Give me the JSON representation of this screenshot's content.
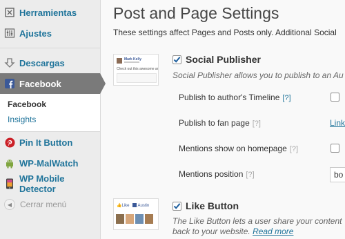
{
  "sidebar": {
    "items": [
      {
        "label": "Herramientas",
        "icon": "tools-icon"
      },
      {
        "label": "Ajustes",
        "icon": "settings-icon"
      },
      {
        "label": "Descargas",
        "icon": "download-icon"
      },
      {
        "label": "Facebook",
        "icon": "facebook-icon"
      },
      {
        "label": "Pin It Button",
        "icon": "pinterest-icon"
      },
      {
        "label": "WP-MalWatch",
        "icon": "android-icon"
      },
      {
        "label": "WP Mobile Detector",
        "icon": "mobile-icon"
      }
    ],
    "submenu": [
      "Facebook",
      "Insights"
    ],
    "collapse_label": "Cerrar menú"
  },
  "main": {
    "title": "Post and Page Settings",
    "description": "These settings affect Pages and Posts only. Additional Social",
    "social_publisher": {
      "heading": "Social Publisher",
      "description": "Social Publisher allows you to publish to an Au",
      "rows": [
        {
          "label": "Publish to author's Timeline",
          "help": "[?]"
        },
        {
          "label": "Publish to fan page",
          "help": "[?]",
          "link": "Link"
        },
        {
          "label": "Mentions show on homepage",
          "help": "[?]"
        },
        {
          "label": "Mentions position",
          "help": "[?]",
          "select_value": "bo"
        }
      ]
    },
    "like_button": {
      "heading": "Like Button",
      "description_line1": "The Like Button lets a user share your content",
      "description_line2": "back to your website.",
      "read_more": "Read more"
    },
    "thumb1": {
      "name": "Mark Kelly",
      "text": "Check out this awesome ar"
    },
    "thumb2": {
      "like": "Like",
      "name": "Austin"
    }
  },
  "colors": {
    "link": "#21759b",
    "active_menu": "#7a7a7a",
    "sidebar_bg": "#ececec",
    "facebook_blue": "#3b5998",
    "pinterest_red": "#cb2027"
  }
}
